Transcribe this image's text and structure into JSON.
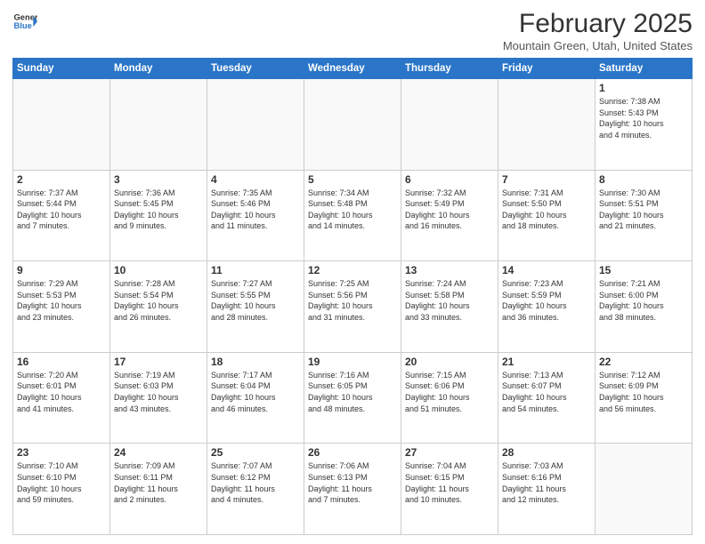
{
  "logo": {
    "line1": "General",
    "line2": "Blue",
    "arrow_color": "#2a75c7"
  },
  "title": "February 2025",
  "subtitle": "Mountain Green, Utah, United States",
  "headers": [
    "Sunday",
    "Monday",
    "Tuesday",
    "Wednesday",
    "Thursday",
    "Friday",
    "Saturday"
  ],
  "weeks": [
    [
      {
        "day": "",
        "info": ""
      },
      {
        "day": "",
        "info": ""
      },
      {
        "day": "",
        "info": ""
      },
      {
        "day": "",
        "info": ""
      },
      {
        "day": "",
        "info": ""
      },
      {
        "day": "",
        "info": ""
      },
      {
        "day": "1",
        "info": "Sunrise: 7:38 AM\nSunset: 5:43 PM\nDaylight: 10 hours\nand 4 minutes."
      }
    ],
    [
      {
        "day": "2",
        "info": "Sunrise: 7:37 AM\nSunset: 5:44 PM\nDaylight: 10 hours\nand 7 minutes."
      },
      {
        "day": "3",
        "info": "Sunrise: 7:36 AM\nSunset: 5:45 PM\nDaylight: 10 hours\nand 9 minutes."
      },
      {
        "day": "4",
        "info": "Sunrise: 7:35 AM\nSunset: 5:46 PM\nDaylight: 10 hours\nand 11 minutes."
      },
      {
        "day": "5",
        "info": "Sunrise: 7:34 AM\nSunset: 5:48 PM\nDaylight: 10 hours\nand 14 minutes."
      },
      {
        "day": "6",
        "info": "Sunrise: 7:32 AM\nSunset: 5:49 PM\nDaylight: 10 hours\nand 16 minutes."
      },
      {
        "day": "7",
        "info": "Sunrise: 7:31 AM\nSunset: 5:50 PM\nDaylight: 10 hours\nand 18 minutes."
      },
      {
        "day": "8",
        "info": "Sunrise: 7:30 AM\nSunset: 5:51 PM\nDaylight: 10 hours\nand 21 minutes."
      }
    ],
    [
      {
        "day": "9",
        "info": "Sunrise: 7:29 AM\nSunset: 5:53 PM\nDaylight: 10 hours\nand 23 minutes."
      },
      {
        "day": "10",
        "info": "Sunrise: 7:28 AM\nSunset: 5:54 PM\nDaylight: 10 hours\nand 26 minutes."
      },
      {
        "day": "11",
        "info": "Sunrise: 7:27 AM\nSunset: 5:55 PM\nDaylight: 10 hours\nand 28 minutes."
      },
      {
        "day": "12",
        "info": "Sunrise: 7:25 AM\nSunset: 5:56 PM\nDaylight: 10 hours\nand 31 minutes."
      },
      {
        "day": "13",
        "info": "Sunrise: 7:24 AM\nSunset: 5:58 PM\nDaylight: 10 hours\nand 33 minutes."
      },
      {
        "day": "14",
        "info": "Sunrise: 7:23 AM\nSunset: 5:59 PM\nDaylight: 10 hours\nand 36 minutes."
      },
      {
        "day": "15",
        "info": "Sunrise: 7:21 AM\nSunset: 6:00 PM\nDaylight: 10 hours\nand 38 minutes."
      }
    ],
    [
      {
        "day": "16",
        "info": "Sunrise: 7:20 AM\nSunset: 6:01 PM\nDaylight: 10 hours\nand 41 minutes."
      },
      {
        "day": "17",
        "info": "Sunrise: 7:19 AM\nSunset: 6:03 PM\nDaylight: 10 hours\nand 43 minutes."
      },
      {
        "day": "18",
        "info": "Sunrise: 7:17 AM\nSunset: 6:04 PM\nDaylight: 10 hours\nand 46 minutes."
      },
      {
        "day": "19",
        "info": "Sunrise: 7:16 AM\nSunset: 6:05 PM\nDaylight: 10 hours\nand 48 minutes."
      },
      {
        "day": "20",
        "info": "Sunrise: 7:15 AM\nSunset: 6:06 PM\nDaylight: 10 hours\nand 51 minutes."
      },
      {
        "day": "21",
        "info": "Sunrise: 7:13 AM\nSunset: 6:07 PM\nDaylight: 10 hours\nand 54 minutes."
      },
      {
        "day": "22",
        "info": "Sunrise: 7:12 AM\nSunset: 6:09 PM\nDaylight: 10 hours\nand 56 minutes."
      }
    ],
    [
      {
        "day": "23",
        "info": "Sunrise: 7:10 AM\nSunset: 6:10 PM\nDaylight: 10 hours\nand 59 minutes."
      },
      {
        "day": "24",
        "info": "Sunrise: 7:09 AM\nSunset: 6:11 PM\nDaylight: 11 hours\nand 2 minutes."
      },
      {
        "day": "25",
        "info": "Sunrise: 7:07 AM\nSunset: 6:12 PM\nDaylight: 11 hours\nand 4 minutes."
      },
      {
        "day": "26",
        "info": "Sunrise: 7:06 AM\nSunset: 6:13 PM\nDaylight: 11 hours\nand 7 minutes."
      },
      {
        "day": "27",
        "info": "Sunrise: 7:04 AM\nSunset: 6:15 PM\nDaylight: 11 hours\nand 10 minutes."
      },
      {
        "day": "28",
        "info": "Sunrise: 7:03 AM\nSunset: 6:16 PM\nDaylight: 11 hours\nand 12 minutes."
      },
      {
        "day": "",
        "info": ""
      }
    ]
  ]
}
